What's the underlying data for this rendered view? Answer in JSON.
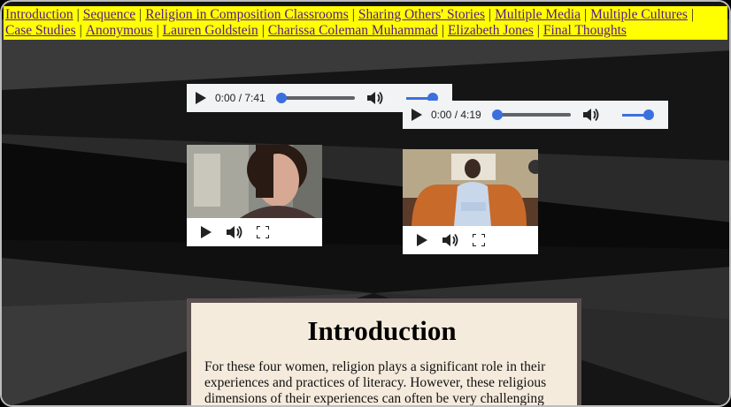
{
  "nav": {
    "links": [
      "Introduction",
      "Sequence",
      "Religion in Composition Classrooms",
      "Sharing Others' Stories",
      "Multiple Media",
      "Multiple Cultures",
      "Case Studies",
      "Anonymous",
      "Lauren Goldstein",
      "Charissa Coleman Muhammad",
      "Elizabeth Jones",
      "Final Thoughts"
    ],
    "separator": "|"
  },
  "audio": [
    {
      "time": "0:00 / 7:41",
      "progress": 0,
      "volume": 1
    },
    {
      "time": "0:00 / 4:19",
      "progress": 0,
      "volume": 1
    }
  ],
  "icons": [
    "play-icon",
    "volume-icon",
    "fullscreen-icon"
  ],
  "colors": {
    "nav_bg": "#ffff00",
    "link": "#551a8b",
    "accent": "#3b6fe0",
    "paper": "#f5ebdd"
  },
  "content": {
    "heading": "Introduction",
    "body": "For these four women, religion plays a significant role in their experiences and practices of literacy. However, these religious dimensions of their experiences can often be very challenging"
  }
}
